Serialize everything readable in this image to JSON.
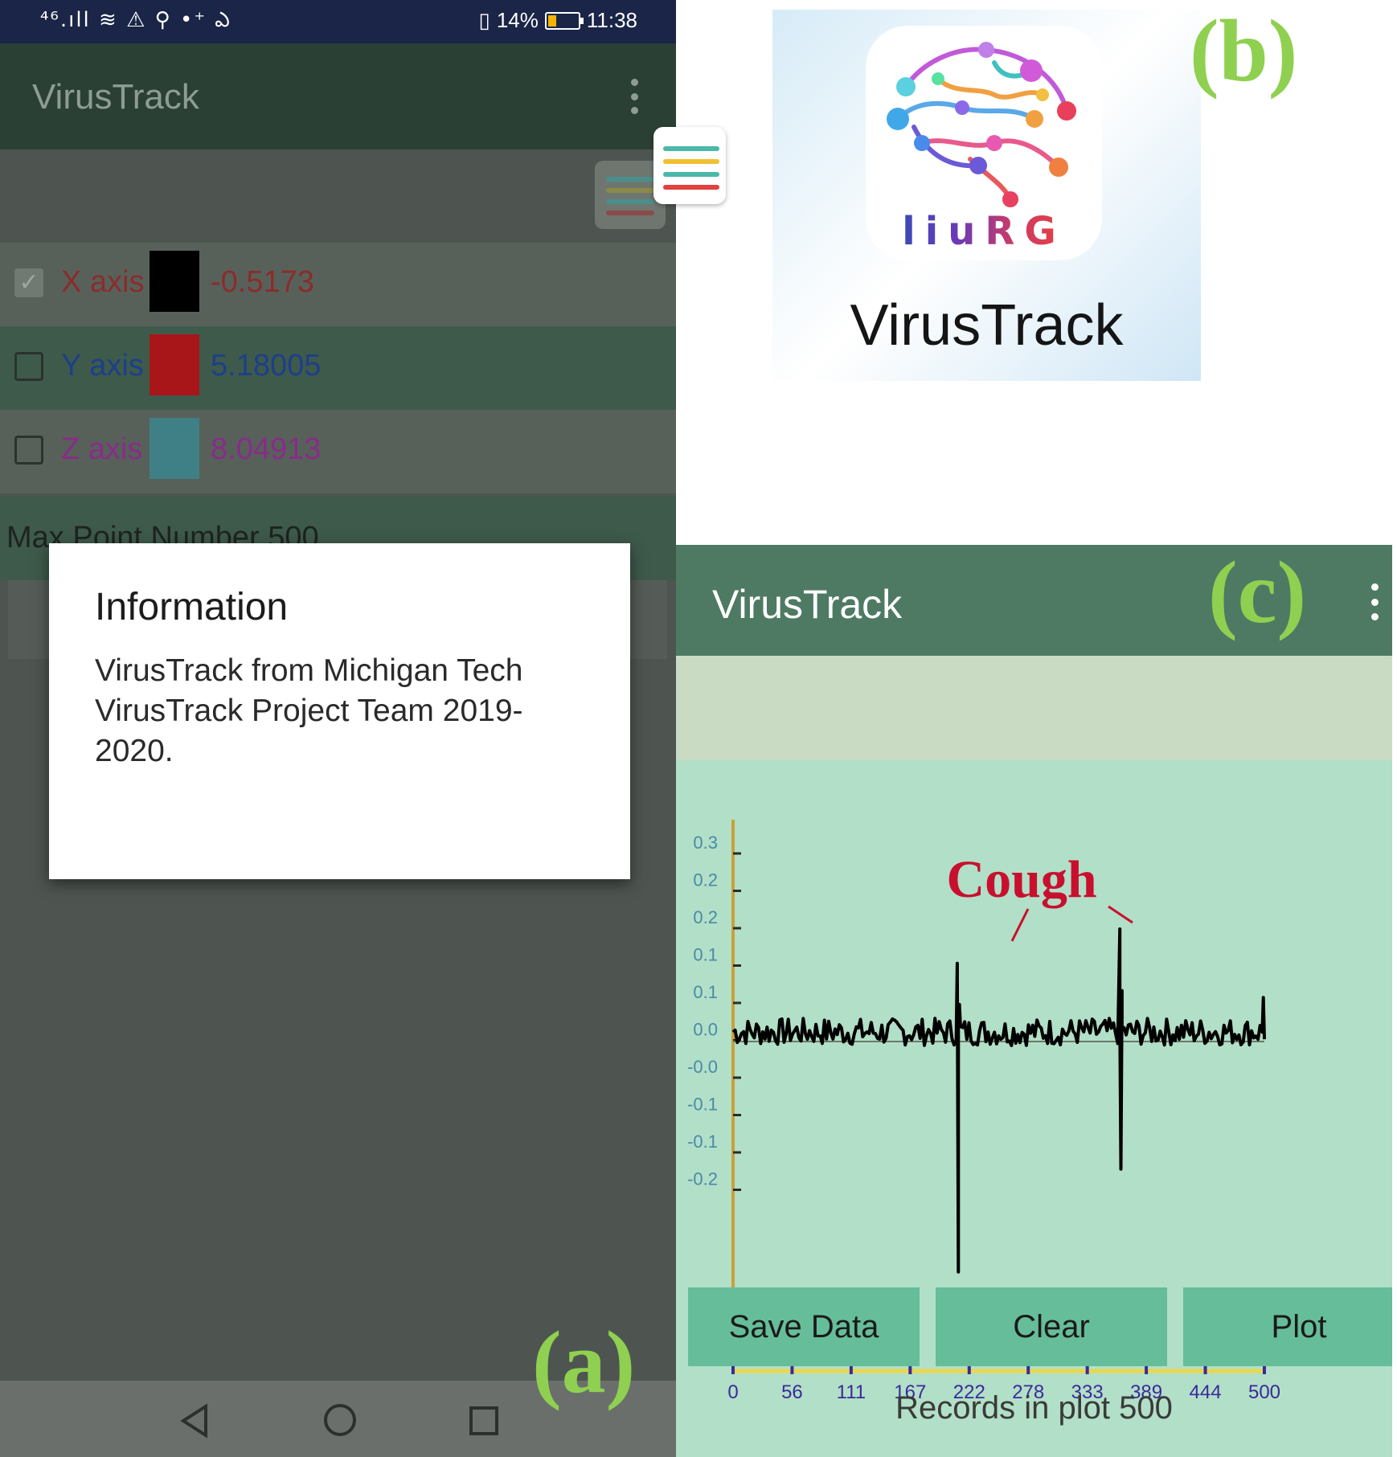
{
  "panel_labels": {
    "a": "(a)",
    "b": "(b)",
    "c": "(c)"
  },
  "colors": {
    "accent_label": "#8fd050",
    "cough_annotation": "#c8102e"
  },
  "panel_a": {
    "status_bar": {
      "left_icons": "⁴⁶.ıll ≋ ⚠ ⚲ •⁺ ఎ",
      "battery_percent": "14%",
      "time": "11:38"
    },
    "app_title": "VirusTrack",
    "overflow_icon": "more-vert-icon",
    "axes": [
      {
        "label": "X axis",
        "checked": true,
        "value": "-0.5173",
        "label_color": "#8c2b2b",
        "swatch_color": "#000000"
      },
      {
        "label": "Y axis",
        "checked": false,
        "value": "5.18005",
        "label_color": "#1d3f8a",
        "swatch_color": "#c4161c"
      },
      {
        "label": "Z axis",
        "checked": false,
        "value": "8.04913",
        "label_color": "#8a2b8a",
        "swatch_color": "#4b9ea7"
      }
    ],
    "max_point": {
      "text": "Max Point Number   500"
    },
    "dialog": {
      "title": "Information",
      "body": "VirusTrack from Michigan Tech VirusTrack Project Team 2019-2020."
    },
    "nav_icons": [
      "back-icon",
      "home-icon",
      "recents-icon"
    ]
  },
  "panel_b": {
    "logo_text": "liuRG",
    "app_name": "VirusTrack"
  },
  "panel_c": {
    "app_title": "VirusTrack",
    "annotation": "Cough",
    "buttons": [
      "Save Data",
      "Clear",
      "Plot"
    ],
    "records_text": "Records in plot 500"
  },
  "chart_data": {
    "type": "line",
    "title": "",
    "xlabel": "",
    "ylabel": "",
    "x_ticks": [
      "0",
      "56",
      "111",
      "167",
      "222",
      "278",
      "333",
      "389",
      "444",
      "500"
    ],
    "y_ticks": [
      "0.3",
      "0.2",
      "0.2",
      "0.1",
      "0.1",
      "0.0",
      "-0.0",
      "-0.1",
      "-0.1",
      "-0.2"
    ],
    "xlim": [
      0,
      500
    ],
    "ylim": [
      -0.25,
      0.3
    ],
    "grid": false,
    "series": [
      {
        "color": "#000000",
        "baseline": 0.0,
        "noise_amplitude": 0.02,
        "events": [
          {
            "x": 212,
            "peak": 0.1,
            "trough": -0.35
          },
          {
            "x": 365,
            "peak": 0.15,
            "trough": -0.2
          }
        ],
        "end_value": 0.05
      }
    ]
  }
}
